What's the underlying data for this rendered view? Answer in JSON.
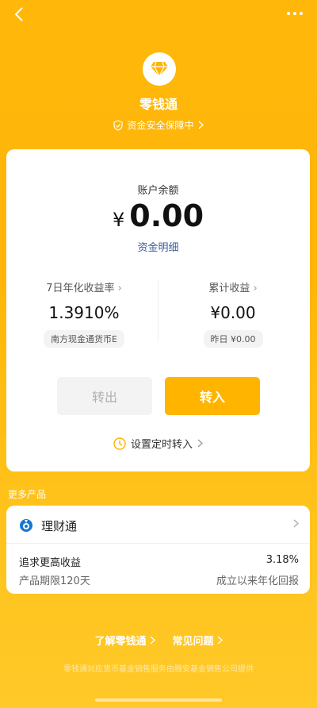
{
  "nav": {
    "back_icon": "chevron-left-icon",
    "more_icon": "more-dots-icon"
  },
  "brand": {
    "name": "零钱通",
    "logo_icon": "diamond-icon",
    "safety_text": "资金安全保障中",
    "safety_icon": "shield-check-icon"
  },
  "account": {
    "balance_label": "账户余额",
    "currency": "¥",
    "balance": "0.00",
    "detail_link": "资金明细",
    "yield_label": "7日年化收益率",
    "yield_value": "1.3910%",
    "fund_name": "南方现金通货币E",
    "earnings_label": "累计收益",
    "earnings_value": "¥0.00",
    "yesterday": "昨日 ¥0.00",
    "transfer_out": "转出",
    "transfer_in": "转入",
    "schedule": "设置定时转入"
  },
  "more_products": {
    "label": "更多产品",
    "product_name": "理财通",
    "product_icon": "licaitong-icon",
    "row1_left": "追求更高收益",
    "row1_right": "3.18%",
    "row2_left": "产品期限120天",
    "row2_right": "成立以来年化回报"
  },
  "footer": {
    "learn": "了解零钱通",
    "faq": "常见问题",
    "note": "零钱通对应货币基金销售服务由腾安基金销售公司提供"
  },
  "colors": {
    "brand": "#ffb400",
    "link": "#3a5f9a"
  }
}
